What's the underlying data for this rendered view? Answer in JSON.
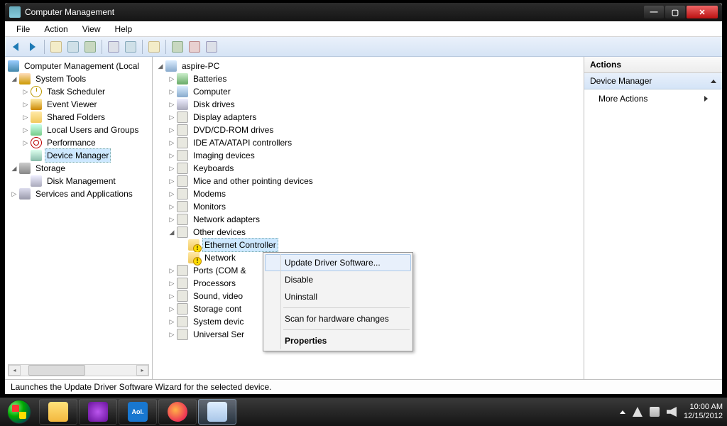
{
  "window": {
    "title": "Computer Management"
  },
  "menu": {
    "file": "File",
    "action": "Action",
    "view": "View",
    "help": "Help"
  },
  "leftTree": {
    "root": "Computer Management (Local",
    "systools": "System Tools",
    "taskSched": "Task Scheduler",
    "eventViewer": "Event Viewer",
    "sharedFolders": "Shared Folders",
    "localUsers": "Local Users and Groups",
    "performance": "Performance",
    "deviceManager": "Device Manager",
    "storage": "Storage",
    "diskMgmt": "Disk Management",
    "services": "Services and Applications"
  },
  "midTree": {
    "root": "aspire-PC",
    "batteries": "Batteries",
    "computer": "Computer",
    "diskDrives": "Disk drives",
    "displayAdapters": "Display adapters",
    "dvd": "DVD/CD-ROM drives",
    "ide": "IDE ATA/ATAPI controllers",
    "imaging": "Imaging devices",
    "keyboards": "Keyboards",
    "mice": "Mice and other pointing devices",
    "modems": "Modems",
    "monitors": "Monitors",
    "netAdapters": "Network adapters",
    "otherDevices": "Other devices",
    "ethCtrl": "Ethernet Controller",
    "netCtrl": "Network",
    "ports": "Ports (COM &",
    "processors": "Processors",
    "sound": "Sound, video",
    "storageCtrl": "Storage cont",
    "sysDevices": "System devic",
    "usb": "Universal Ser"
  },
  "ctx": {
    "update": "Update Driver Software...",
    "disable": "Disable",
    "uninstall": "Uninstall",
    "scan": "Scan for hardware changes",
    "properties": "Properties"
  },
  "actions": {
    "header": "Actions",
    "dm": "Device Manager",
    "more": "More Actions"
  },
  "status": "Launches the Update Driver Software Wizard for the selected device.",
  "taskbar": {
    "aol": "Aol."
  },
  "tray": {
    "time": "10:00 AM",
    "date": "12/15/2012"
  }
}
